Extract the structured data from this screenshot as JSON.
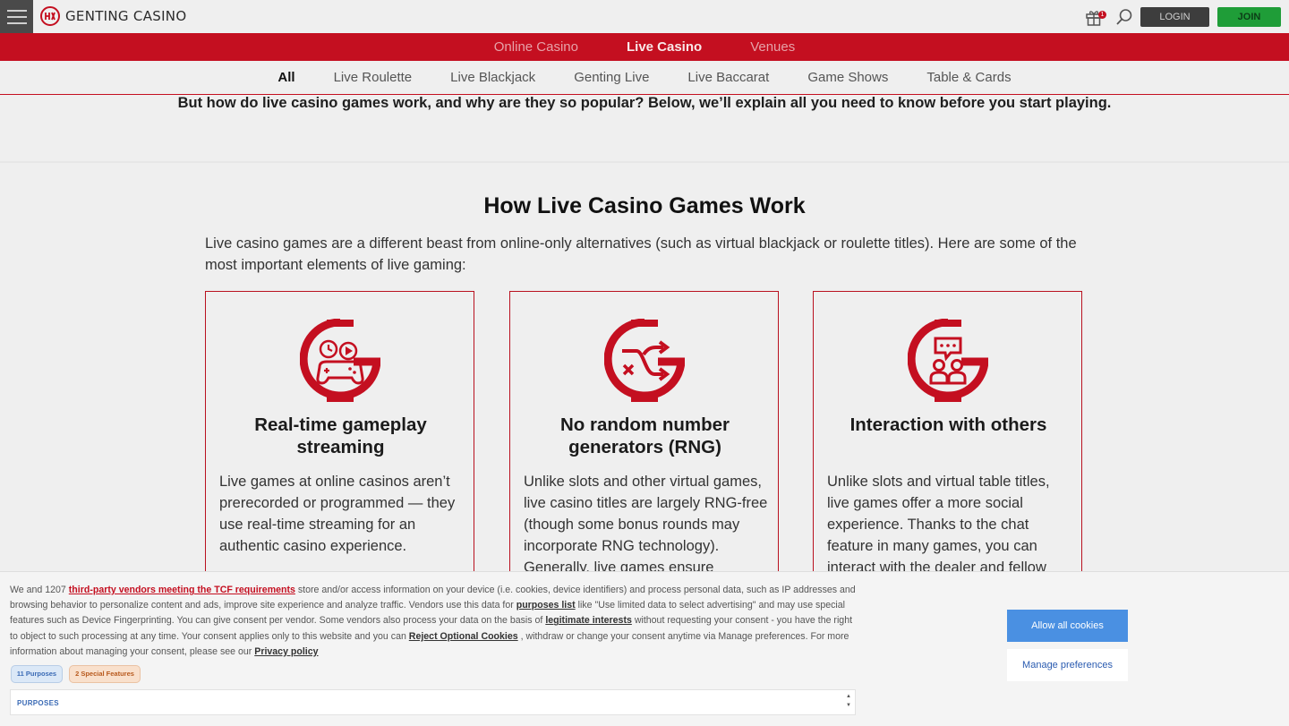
{
  "header": {
    "brand": "GENTING CASINO",
    "gift_badge": "1",
    "login_label": "LOGIN",
    "join_label": "JOIN",
    "icons": [
      "menu-icon",
      "genting-logo",
      "gift-icon",
      "search-icon"
    ]
  },
  "main_nav": {
    "items": [
      {
        "label": "Online Casino",
        "active": false
      },
      {
        "label": "Live Casino",
        "active": true
      },
      {
        "label": "Venues",
        "active": false
      }
    ]
  },
  "sub_nav": {
    "items": [
      {
        "label": "All",
        "active": true
      },
      {
        "label": "Live Roulette",
        "active": false
      },
      {
        "label": "Live Blackjack",
        "active": false
      },
      {
        "label": "Genting Live",
        "active": false
      },
      {
        "label": "Live Baccarat",
        "active": false
      },
      {
        "label": "Game Shows",
        "active": false
      },
      {
        "label": "Table & Cards",
        "active": false
      }
    ]
  },
  "content": {
    "intro": "But how do live casino games work, and why are they so popular? Below, we’ll explain all you need to know before you start playing.",
    "heading": "How Live Casino Games Work",
    "lead": "Live casino games are a different beast from online-only alternatives (such as virtual blackjack or roulette titles). Here are some of the most important elements of live gaming:",
    "cards": [
      {
        "icon": "gamepad-clock-icon",
        "title": "Real-time gameplay streaming",
        "text": "Live games at online casinos aren’t prerecorded or programmed — they use real-time streaming for an authentic casino experience."
      },
      {
        "icon": "shuffle-icon",
        "title": "No random number generators (RNG)",
        "text": "Unlike slots and other virtual games, live casino titles are largely RNG-free (though some bonus rounds may incorporate RNG technology). Generally, live games ensure"
      },
      {
        "icon": "chat-people-icon",
        "title": "Interaction with others",
        "text": "Unlike slots and virtual table titles, live games offer a more social experience. Thanks to the chat feature in many games, you can interact with the dealer and fellow"
      }
    ]
  },
  "consent": {
    "t1": "We and 1207 ",
    "link_vendors": "third-party vendors meeting the TCF requirements",
    "t2": " store and/or access information on your device (i.e. cookies, device identifiers) and process personal data, such as IP addresses and browsing behavior to personalize content and ads, improve site experience and analyze traffic. Vendors use this data for ",
    "link_purposes": "purposes list",
    "t3": "  like \"Use limited data to select advertising\" and may use special features such as Device Fingerprinting. You can give consent per vendor. Some vendors also process your data on the basis of ",
    "link_legit": "legitimate interests",
    "t4": "  without requesting your consent - you have the right to object to such processing at any time. Your consent applies only to this website and you can ",
    "link_reject": "Reject Optional Cookies",
    "t5": " , withdraw or change your consent anytime via Manage preferences. For more information about managing your consent, please see our ",
    "link_privacy": "Privacy policy",
    "pill_purposes": "11 Purposes",
    "pill_features": "2 Special Features",
    "purposes_label": "PURPOSES",
    "allow_label": "Allow all cookies",
    "manage_label": "Manage preferences"
  },
  "colors": {
    "brand_red": "#c40f20",
    "join_green": "#1f9d38",
    "allow_blue": "#4a90e2"
  }
}
